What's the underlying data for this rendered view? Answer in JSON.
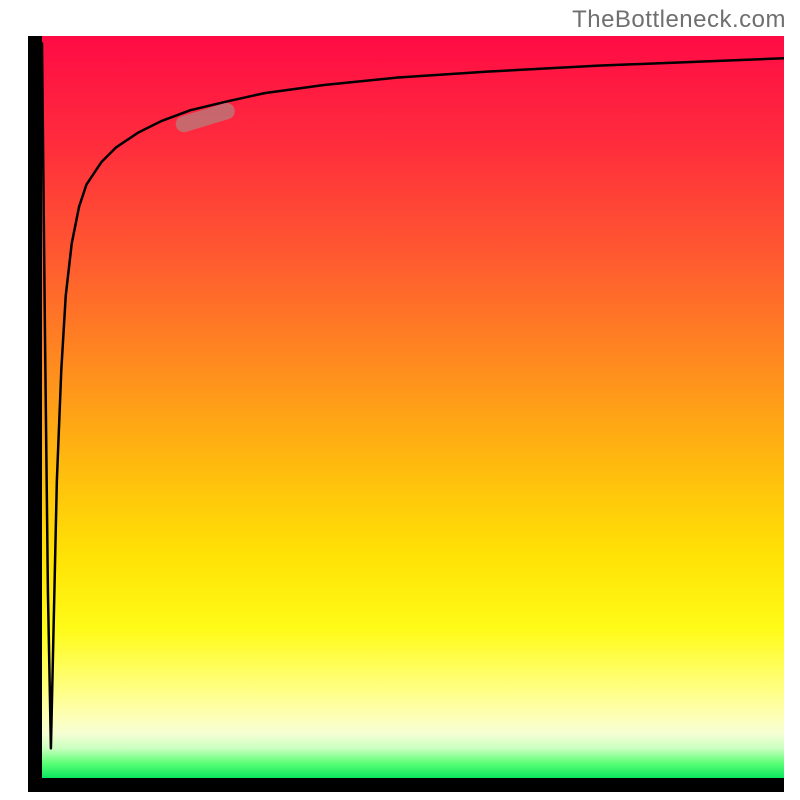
{
  "attribution": "TheBottleneck.com",
  "colors": {
    "frame": "#000000",
    "curve": "#000000",
    "marker": "#b97a7a",
    "gradient_stops": [
      "#ff0b45",
      "#ff5a30",
      "#ffbb0e",
      "#fffb18",
      "#ffff82",
      "#09e85f"
    ]
  },
  "chart_data": {
    "type": "line",
    "title": "",
    "xlabel": "",
    "ylabel": "",
    "xlim": [
      0,
      100
    ],
    "ylim": [
      0,
      100
    ],
    "grid": false,
    "annotations": [
      {
        "type": "pill_marker",
        "approx_x": 22,
        "approx_y": 89
      }
    ],
    "series": [
      {
        "name": "dip-curve",
        "x": [
          0,
          0.4,
          0.8,
          1.2,
          1.6,
          2.0,
          2.6,
          3.2,
          4,
          5,
          6,
          8,
          10,
          13,
          16,
          20,
          25,
          30,
          38,
          48,
          60,
          75,
          90,
          100
        ],
        "y": [
          99,
          60,
          25,
          4,
          22,
          40,
          55,
          65,
          72,
          77,
          80,
          83,
          85,
          87,
          88.5,
          90,
          91.2,
          92.3,
          93.4,
          94.4,
          95.2,
          96.0,
          96.6,
          97.0
        ]
      }
    ]
  }
}
